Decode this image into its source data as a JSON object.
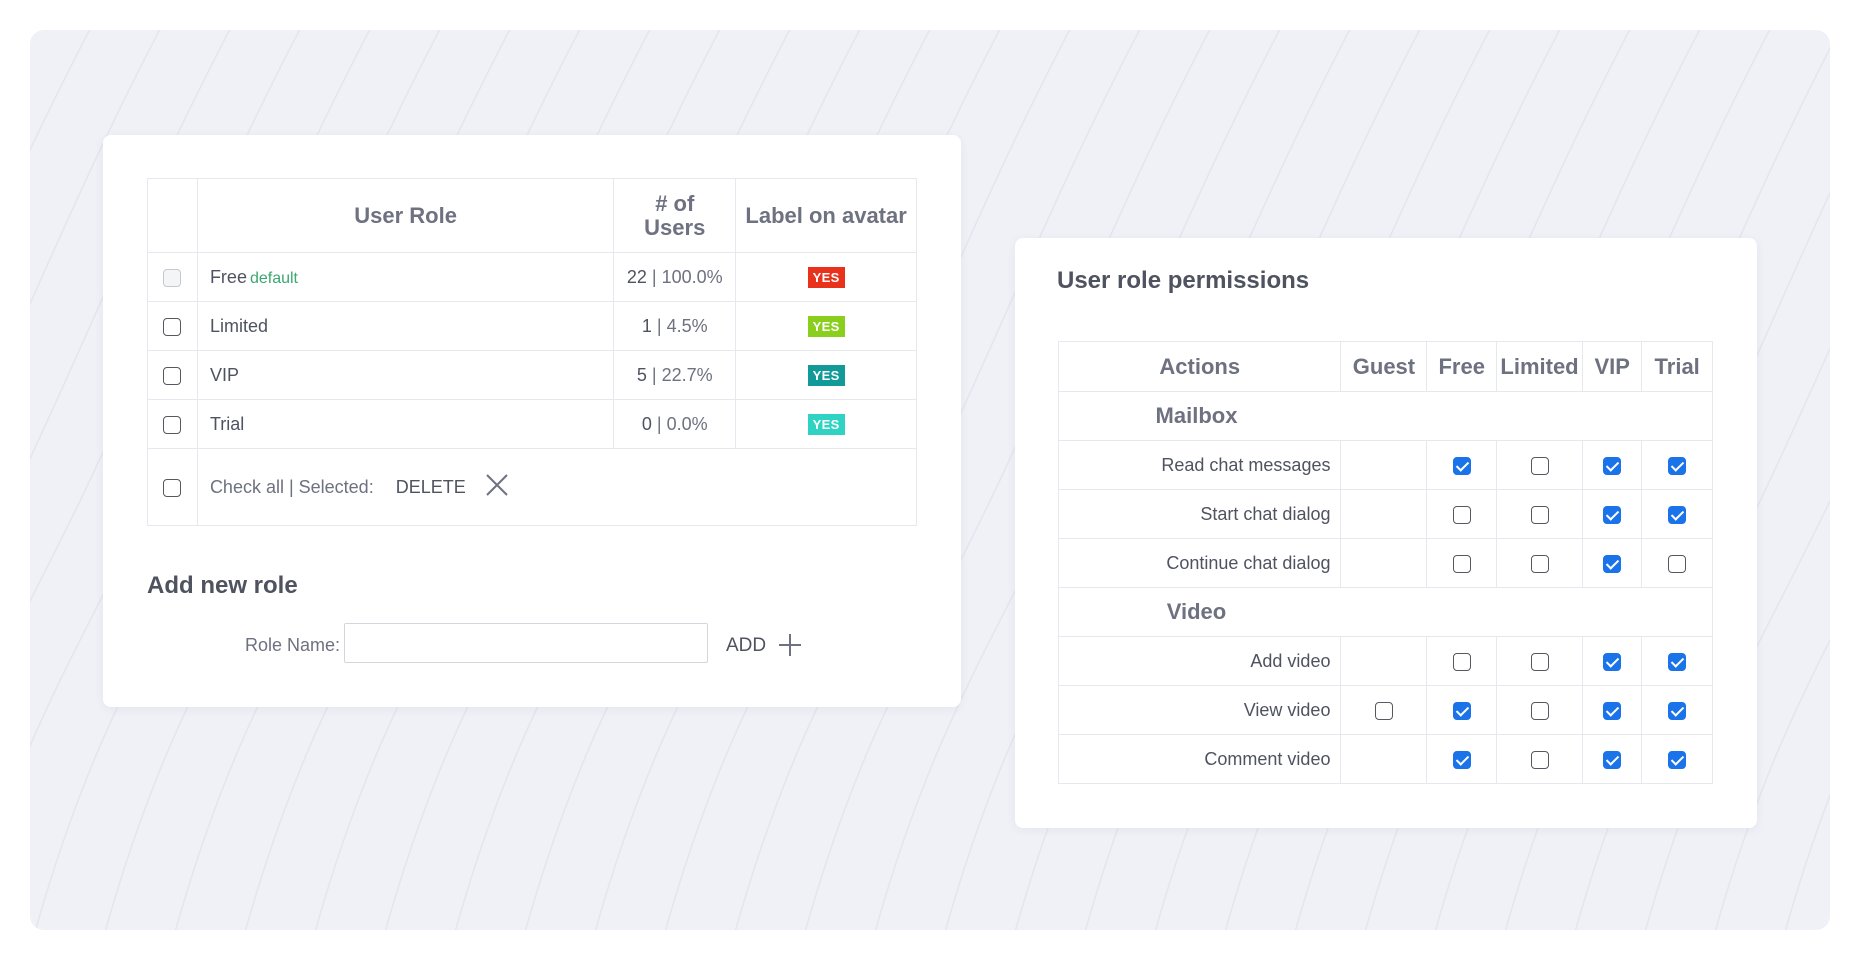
{
  "roles_table": {
    "headers": {
      "user_role": "User Role",
      "num_users": "# of Users",
      "label_on_avatar": "Label on avatar"
    },
    "rows": [
      {
        "name": "Free",
        "tag": "default",
        "count": "22",
        "percent": "100.0%",
        "badge": "YES",
        "badge_color": "#e8321c",
        "checkbox": "disabled"
      },
      {
        "name": "Limited",
        "tag": "",
        "count": "1",
        "percent": "4.5%",
        "badge": "YES",
        "badge_color": "#8bcf1e",
        "checkbox": "unchecked"
      },
      {
        "name": "VIP",
        "tag": "",
        "count": "5",
        "percent": "22.7%",
        "badge": "YES",
        "badge_color": "#129a98",
        "checkbox": "unchecked"
      },
      {
        "name": "Trial",
        "tag": "",
        "count": "0",
        "percent": "0.0%",
        "badge": "YES",
        "badge_color": "#2fd3c4",
        "checkbox": "unchecked"
      }
    ],
    "footer": {
      "check_all_text": "Check all | Selected:",
      "delete_label": "DELETE"
    }
  },
  "add_role": {
    "title": "Add new role",
    "field_label": "Role Name:",
    "field_value": "",
    "add_label": "ADD"
  },
  "permissions": {
    "title": "User role permissions",
    "columns": [
      "Actions",
      "Guest",
      "Free",
      "Limited",
      "VIP",
      "Trial"
    ],
    "sections": [
      {
        "name": "Mailbox",
        "actions": [
          {
            "label": "Read chat messages",
            "values": [
              null,
              true,
              false,
              true,
              true
            ]
          },
          {
            "label": "Start chat dialog",
            "values": [
              null,
              false,
              false,
              true,
              true
            ]
          },
          {
            "label": "Continue chat dialog",
            "values": [
              null,
              false,
              false,
              true,
              false
            ]
          }
        ]
      },
      {
        "name": "Video",
        "actions": [
          {
            "label": "Add video",
            "values": [
              null,
              false,
              false,
              true,
              true
            ]
          },
          {
            "label": "View video",
            "values": [
              false,
              true,
              false,
              true,
              true
            ]
          },
          {
            "label": "Comment video",
            "values": [
              null,
              true,
              false,
              true,
              true
            ]
          }
        ]
      }
    ]
  },
  "colors": {
    "accent": "#1a73e8",
    "default_tag": "#3aa870",
    "background": "#f0f1f7"
  },
  "icons": {
    "delete": "close-icon",
    "add": "plus-icon"
  }
}
